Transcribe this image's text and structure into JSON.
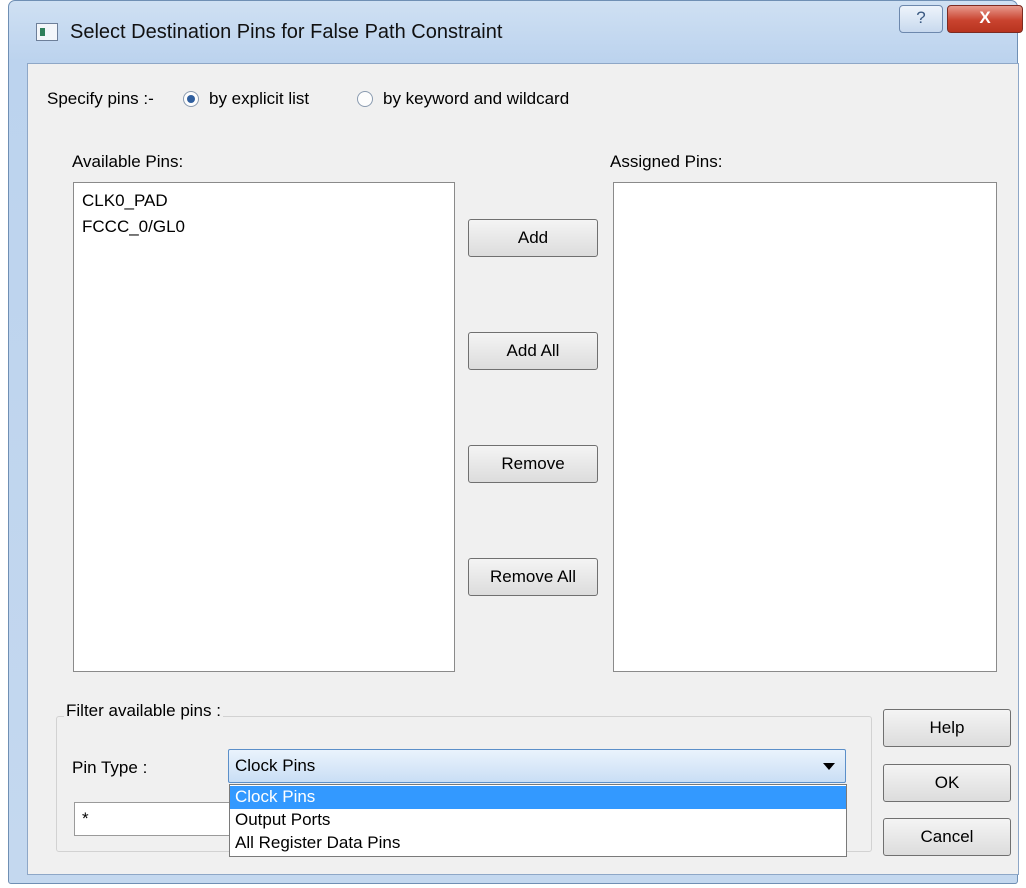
{
  "window": {
    "title": "Select Destination Pins for False Path Constraint",
    "help_glyph": "?",
    "close_glyph": "X"
  },
  "specify": {
    "label": "Specify pins :-",
    "options": [
      {
        "label": "by explicit list",
        "selected": true
      },
      {
        "label": "by keyword and wildcard",
        "selected": false
      }
    ]
  },
  "available": {
    "label": "Available Pins:",
    "items": [
      "CLK0_PAD",
      "FCCC_0/GL0"
    ]
  },
  "assigned": {
    "label": "Assigned Pins:",
    "items": []
  },
  "transfer_buttons": {
    "add": "Add",
    "add_all": "Add All",
    "remove": "Remove",
    "remove_all": "Remove All"
  },
  "filter": {
    "group_label": "Filter available pins :",
    "pin_type_label": "Pin Type :",
    "pin_type_selected": "Clock Pins",
    "pin_type_options": [
      "Clock Pins",
      "Output Ports",
      "All Register Data Pins"
    ],
    "pattern_value": "*"
  },
  "dialog_buttons": {
    "help": "Help",
    "ok": "OK",
    "cancel": "Cancel"
  }
}
